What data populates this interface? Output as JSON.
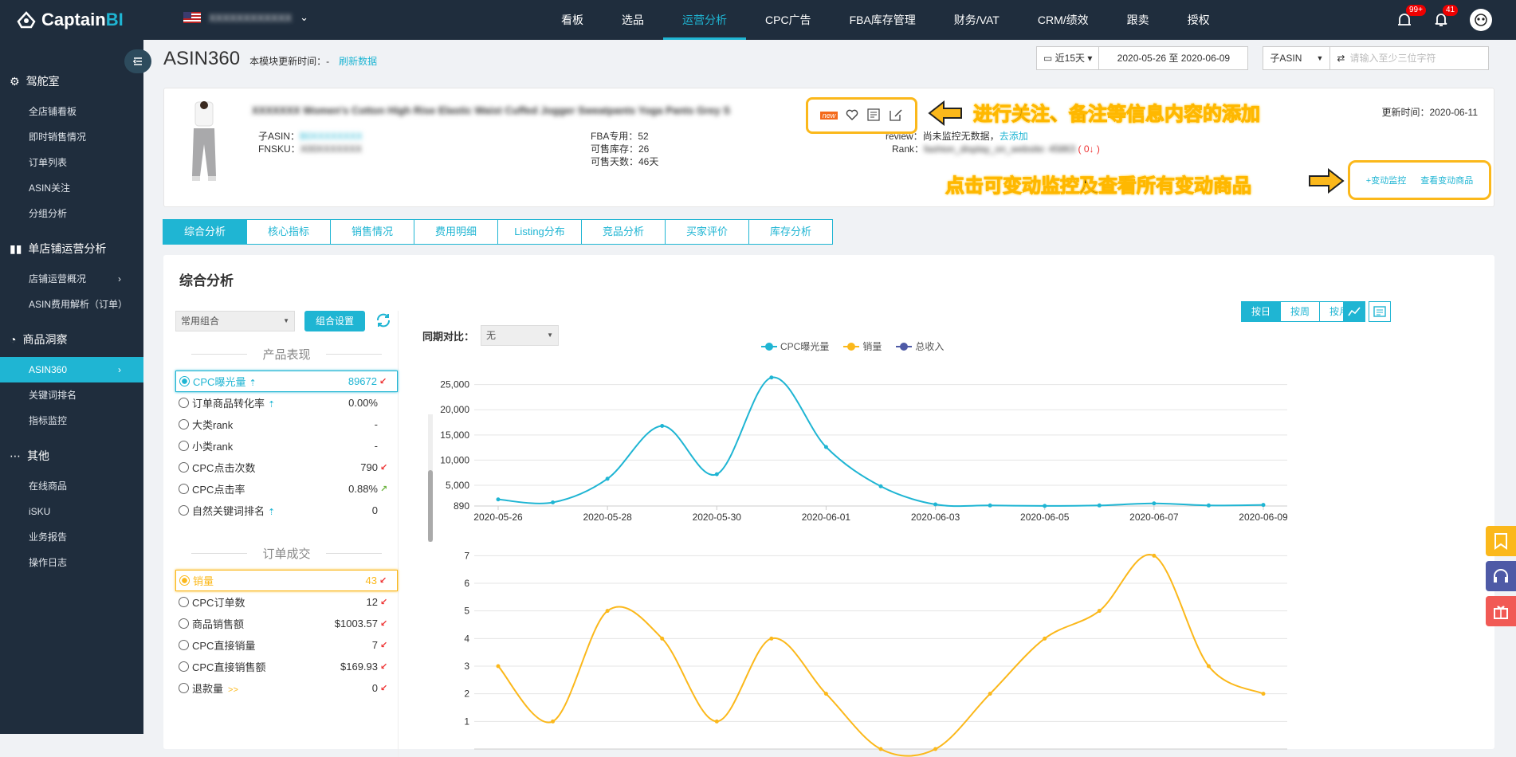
{
  "app": {
    "logo_main": "Captain",
    "logo_accent": "BI",
    "store_name": "XXXXXXXXXXXX"
  },
  "topnav": [
    "看板",
    "选品",
    "运营分析",
    "CPC广告",
    "FBA库存管理",
    "财务/VAT",
    "CRM/绩效",
    "跟卖",
    "授权"
  ],
  "topnav_active": "运营分析",
  "badges": {
    "alerts": "99+",
    "notifications": "41"
  },
  "sidebar": {
    "groups": [
      {
        "label": "驾舵室",
        "icon": "gear-icon",
        "items": [
          "全店铺看板",
          "即时销售情况",
          "订单列表",
          "ASIN关注",
          "分组分析"
        ]
      },
      {
        "label": "单店铺运营分析",
        "icon": "bar-chart-icon",
        "items": [
          "店铺运营概况",
          "ASIN费用解析（订单）"
        ]
      },
      {
        "label": "商品洞察",
        "icon": "pie-chart-icon",
        "items": [
          "ASIN360",
          "关键词排名",
          "指标监控"
        ]
      },
      {
        "label": "其他",
        "icon": "more-icon",
        "items": [
          "在线商品",
          "iSKU",
          "业务报告",
          "操作日志"
        ]
      }
    ],
    "active_item": "ASIN360"
  },
  "header": {
    "title": "ASIN360",
    "update_label": "本模块更新时间：-",
    "refresh": "刷新数据",
    "range_preset": "近15天",
    "date_range": "2020-05-26 至 2020-06-09",
    "asin_type": "子ASIN",
    "search_placeholder": "请输入至少三位字符"
  },
  "product": {
    "title": "XXXXXXX Women's Cotton High Rise Elastic Waist Cuffed Jogger Sweatpants Yoga Pants Grey S",
    "child_asin_label": "子ASIN：",
    "child_asin": "B0XXXXXXXX",
    "fnsku_label": "FNSKU：",
    "fnsku": "X00XXXXXXX",
    "fba_label": "FBA专用：52",
    "sellable_label": "可售库存：26",
    "days_label": "可售天数：46天",
    "review_label": "review：尚未监控无数据，",
    "review_link": "去添加",
    "rank_label": "Rank：",
    "rank_value": "fashion_display_on_website: 45863",
    "rank_change": "( 0↓ )",
    "update_time": "更新时间：2020-06-11",
    "new_badge": "new",
    "monitor_link": "+变动监控",
    "view_changes_link": "查看变动商品"
  },
  "annotations": {
    "a1": "进行关注、备注等信息内容的添加",
    "a2": "点击可变动监控及查看所有变动商品"
  },
  "tabs": [
    "综合分析",
    "核心指标",
    "销售情况",
    "费用明细",
    "Listing分布",
    "竞品分析",
    "买家评价",
    "库存分析"
  ],
  "tabs_active": "综合分析",
  "section": {
    "title": "综合分析",
    "combo": "常用组合",
    "combo_btn": "组合设置",
    "group1": "产品表现",
    "group2": "订单成交",
    "compare_label": "同期对比：",
    "compare_value": "无",
    "toggles": [
      "按日",
      "按周",
      "按月"
    ],
    "toggle_active": "按日"
  },
  "metrics1": [
    {
      "name": "CPC曝光量",
      "value": "89672",
      "trend": "down",
      "up": true,
      "selected": true
    },
    {
      "name": "订单商品转化率",
      "value": "0.00%",
      "trend": "",
      "up": true
    },
    {
      "name": "大类rank",
      "value": "-",
      "trend": ""
    },
    {
      "name": "小类rank",
      "value": "-",
      "trend": ""
    },
    {
      "name": "CPC点击次数",
      "value": "790",
      "trend": "down"
    },
    {
      "name": "CPC点击率",
      "value": "0.88%",
      "trend": "upgreen"
    },
    {
      "name": "自然关键词排名",
      "value": "0",
      "trend": "",
      "up": true
    }
  ],
  "metrics2": [
    {
      "name": "销量",
      "value": "43",
      "trend": "down",
      "selected": true
    },
    {
      "name": "CPC订单数",
      "value": "12",
      "trend": "down"
    },
    {
      "name": "商品销售额",
      "value": "$1003.57",
      "trend": "down"
    },
    {
      "name": "CPC直接销量",
      "value": "7",
      "trend": "down"
    },
    {
      "name": "CPC直接销售额",
      "value": "$169.93",
      "trend": "down"
    },
    {
      "name": "退款量",
      "value": "0",
      "trend": "down",
      "more": ">>"
    }
  ],
  "chart_data": [
    {
      "type": "line",
      "legend": [
        "CPC曝光量",
        "销量",
        "总收入"
      ],
      "colors": [
        "#1fb5d3",
        "#fbb81b",
        "#4e5aa6"
      ],
      "x": [
        "2020-05-26",
        "2020-05-27",
        "2020-05-28",
        "2020-05-29",
        "2020-05-30",
        "2020-05-31",
        "2020-06-01",
        "2020-06-02",
        "2020-06-03",
        "2020-06-04",
        "2020-06-05",
        "2020-06-06",
        "2020-06-07",
        "2020-06-08",
        "2020-06-09"
      ],
      "x_tick_labels": [
        "2020-05-26",
        "2020-05-28",
        "2020-05-30",
        "2020-06-01",
        "2020-06-03",
        "2020-06-05",
        "2020-06-07",
        "2020-06-09"
      ],
      "series": [
        {
          "name": "CPC曝光量",
          "values": [
            2200,
            1600,
            6300,
            16800,
            7200,
            26400,
            12600,
            4800,
            1200,
            1000,
            900,
            1000,
            1400,
            1000,
            1100
          ]
        }
      ],
      "y_ticks": [
        "890",
        "5,000",
        "10,000",
        "15,000",
        "20,000",
        "25,000"
      ],
      "ylim": [
        890,
        27000
      ]
    },
    {
      "type": "line",
      "series": [
        {
          "name": "销量",
          "values": [
            3,
            1,
            5,
            4,
            1,
            4,
            2,
            0,
            0,
            2,
            4,
            5,
            7,
            3,
            2
          ]
        }
      ],
      "y_ticks": [
        "1",
        "2",
        "3",
        "4",
        "5",
        "6",
        "7"
      ],
      "ylim": [
        0,
        7.5
      ]
    }
  ]
}
